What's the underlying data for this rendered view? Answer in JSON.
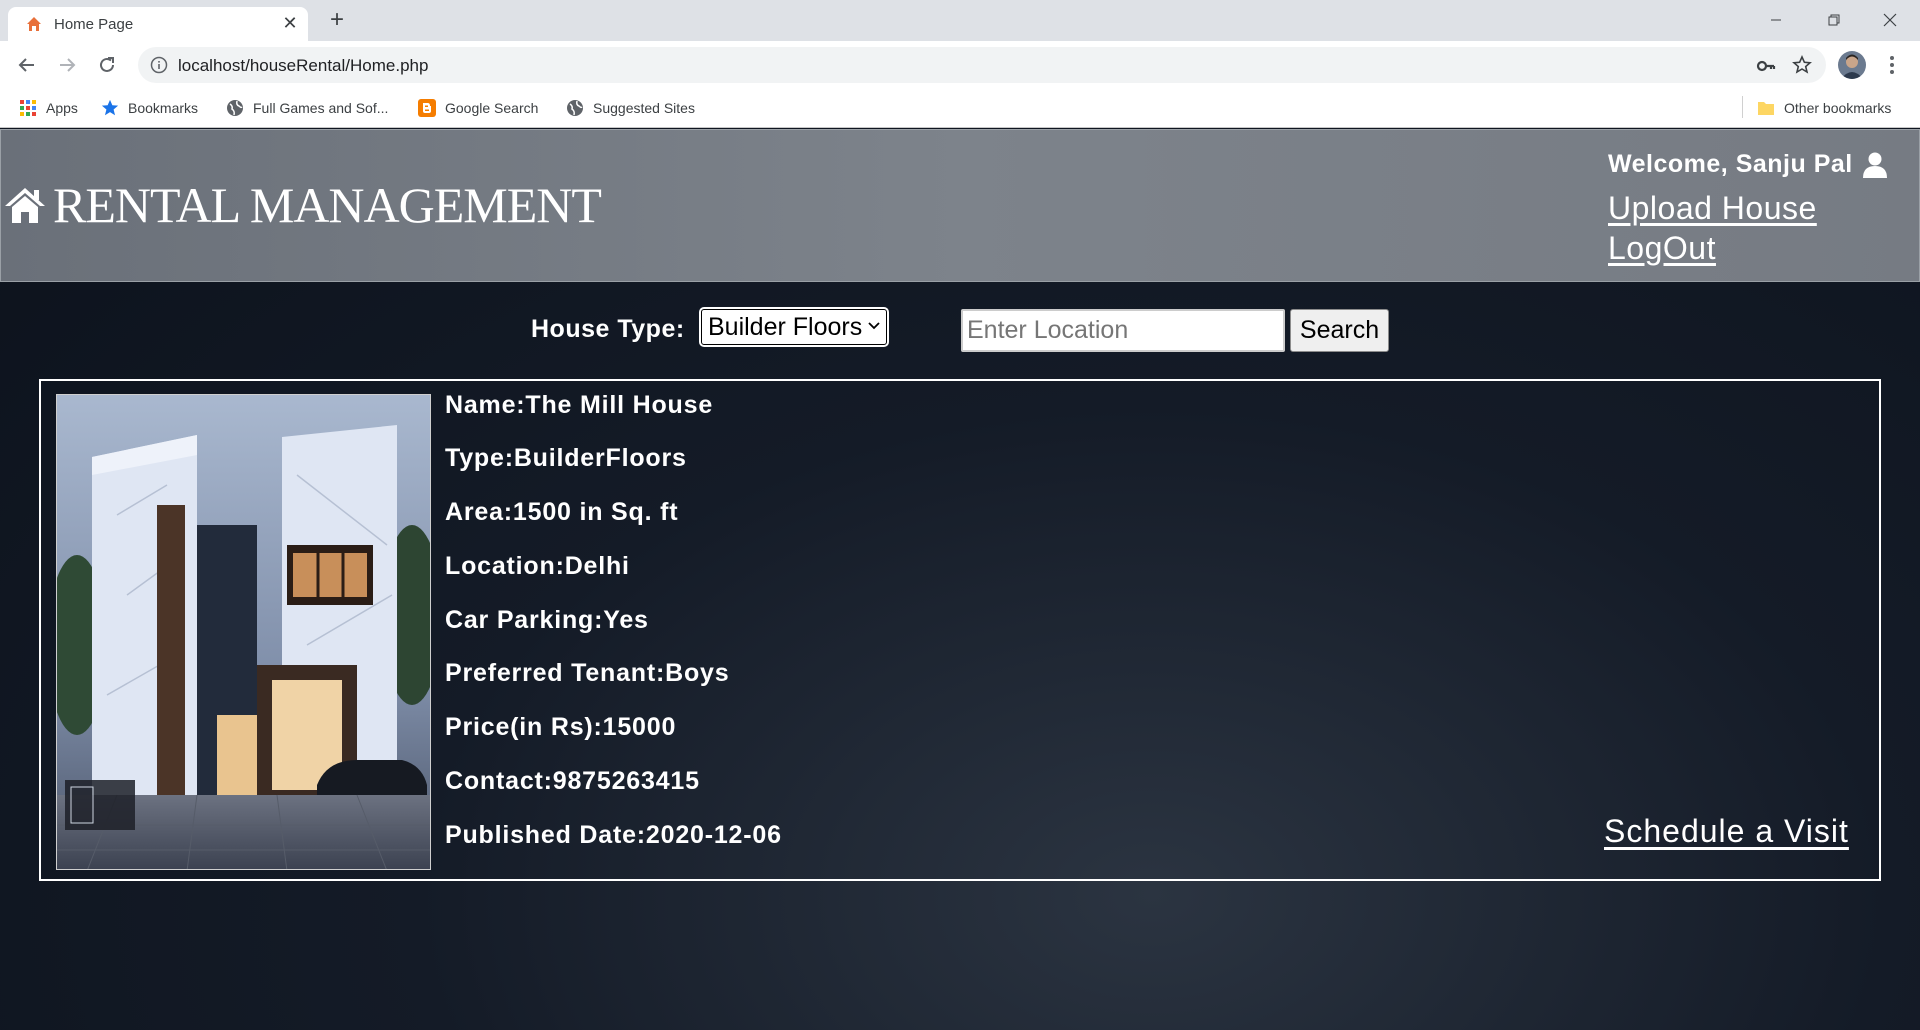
{
  "browser": {
    "tab_title": "Home Page",
    "url": "localhost/houseRental/Home.php",
    "bookmarks": [
      {
        "label": "Apps",
        "icon": "apps-grid-icon"
      },
      {
        "label": "Bookmarks",
        "icon": "star-bookmark-icon"
      },
      {
        "label": "Full Games and Sof...",
        "icon": "globe-icon"
      },
      {
        "label": "Google Search",
        "icon": "blogger-icon"
      },
      {
        "label": "Suggested Sites",
        "icon": "globe-icon"
      }
    ],
    "other_bookmarks": "Other bookmarks"
  },
  "header": {
    "brand": "RENTAL MANAGEMENT",
    "welcome": "Welcome, Sanju Pal",
    "upload_link": "Upload House",
    "logout_link": "LogOut"
  },
  "search": {
    "type_label": "House Type:",
    "type_selected": "Builder Floors",
    "location_placeholder": "Enter Location",
    "search_button": "Search"
  },
  "listing": {
    "name": "Name:The Mill House",
    "type": "Type:BuilderFloors",
    "area": "Area:1500 in Sq. ft",
    "location": "Location:Delhi",
    "parking": "Car Parking:Yes",
    "tenant": "Preferred Tenant:Boys",
    "price": "Price(in Rs):15000",
    "contact": "Contact:9875263415",
    "published": "Published Date:2020-12-06",
    "visit_link": "Schedule a Visit"
  },
  "colors": {
    "header_bg": "#767b83",
    "page_bg": "#141b27",
    "text": "#ffffff"
  }
}
